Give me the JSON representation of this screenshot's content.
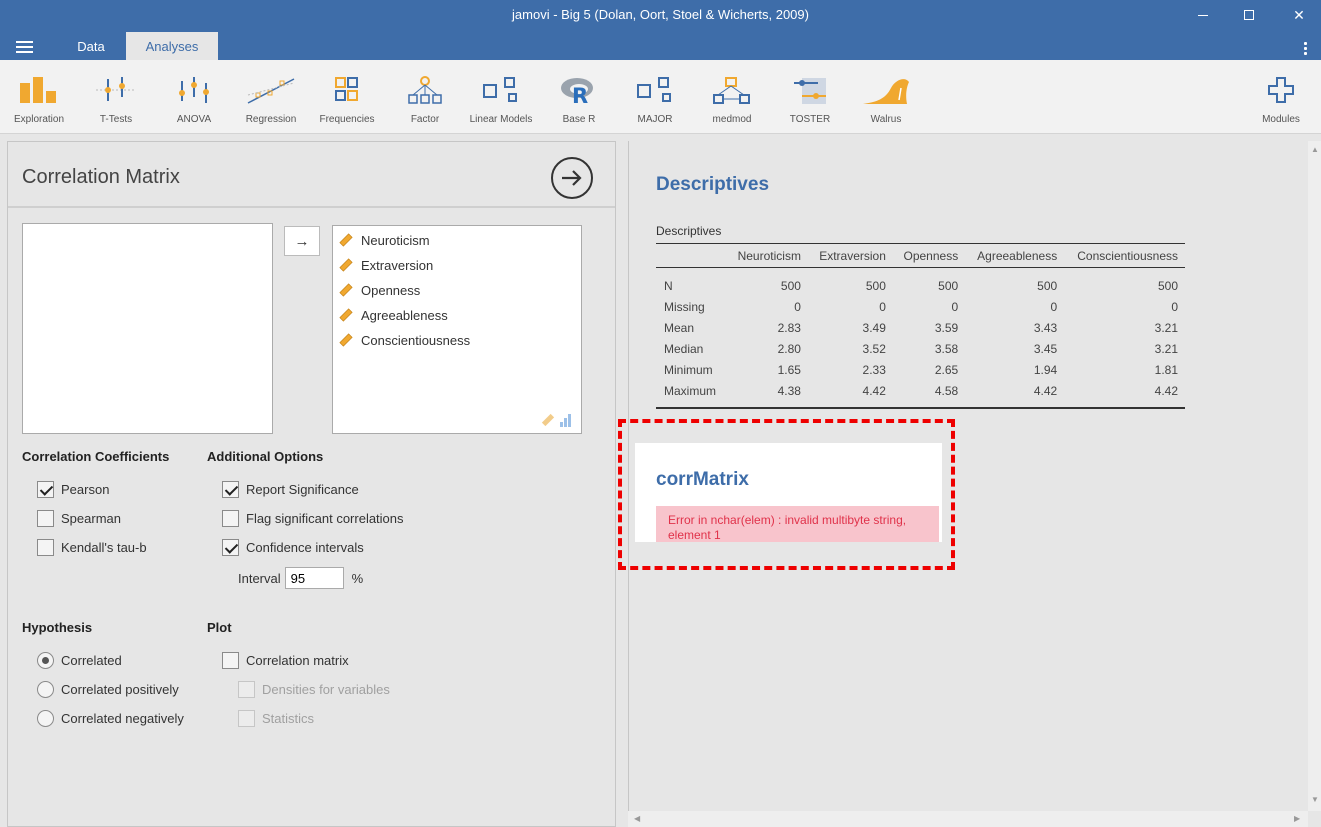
{
  "window": {
    "title": "jamovi - Big 5 (Dolan, Oort, Stoel & Wicherts, 2009)",
    "controls": {
      "minimize": "minimize-icon",
      "maximize": "maximize-icon",
      "close": "✕"
    }
  },
  "tabs": {
    "data": "Data",
    "analyses": "Analyses"
  },
  "ribbon": {
    "items": [
      "Exploration",
      "T-Tests",
      "ANOVA",
      "Regression",
      "Frequencies",
      "Factor",
      "Linear Models",
      "Base R",
      "MAJOR",
      "medmod",
      "TOSTER",
      "Walrus"
    ],
    "modules": "Modules"
  },
  "panel": {
    "title": "Correlation Matrix",
    "move_arrow": "→",
    "variables": [
      "Neuroticism",
      "Extraversion",
      "Openness",
      "Agreeableness",
      "Conscientiousness"
    ],
    "coefficients": {
      "heading": "Correlation Coefficients",
      "pearson": "Pearson",
      "spearman": "Spearman",
      "kendall": "Kendall's tau-b"
    },
    "additional": {
      "heading": "Additional Options",
      "report_sig": "Report Significance",
      "flag_sig": "Flag significant correlations",
      "ci": "Confidence intervals",
      "interval_label": "Interval",
      "interval_value": "95",
      "interval_unit": "%"
    },
    "hypothesis": {
      "heading": "Hypothesis",
      "correlated": "Correlated",
      "positive": "Correlated positively",
      "negative": "Correlated negatively"
    },
    "plot": {
      "heading": "Plot",
      "corr_matrix": "Correlation matrix",
      "densities": "Densities for variables",
      "statistics": "Statistics"
    }
  },
  "results": {
    "descriptives_title": "Descriptives",
    "table_caption": "Descriptives",
    "table_headers": [
      "",
      "Neuroticism",
      "Extraversion",
      "Openness",
      "Agreeableness",
      "Conscientiousness"
    ],
    "rows": [
      [
        "N",
        "500",
        "500",
        "500",
        "500",
        "500"
      ],
      [
        "Missing",
        "0",
        "0",
        "0",
        "0",
        "0"
      ],
      [
        "Mean",
        "2.83",
        "3.49",
        "3.59",
        "3.43",
        "3.21"
      ],
      [
        "Median",
        "2.80",
        "3.52",
        "3.58",
        "3.45",
        "3.21"
      ],
      [
        "Minimum",
        "1.65",
        "2.33",
        "2.65",
        "1.94",
        "1.81"
      ],
      [
        "Maximum",
        "4.38",
        "4.42",
        "4.58",
        "4.42",
        "4.42"
      ]
    ],
    "corr_title": "corrMatrix",
    "error": "Error in nchar(elem) : invalid multibyte string, element 1"
  },
  "colors": {
    "brand": "#3e6da9",
    "error_bg": "#f8c4cc",
    "error_text": "#e0324a",
    "highlight": "#ee0000",
    "icon_orange": "#f0a830"
  }
}
